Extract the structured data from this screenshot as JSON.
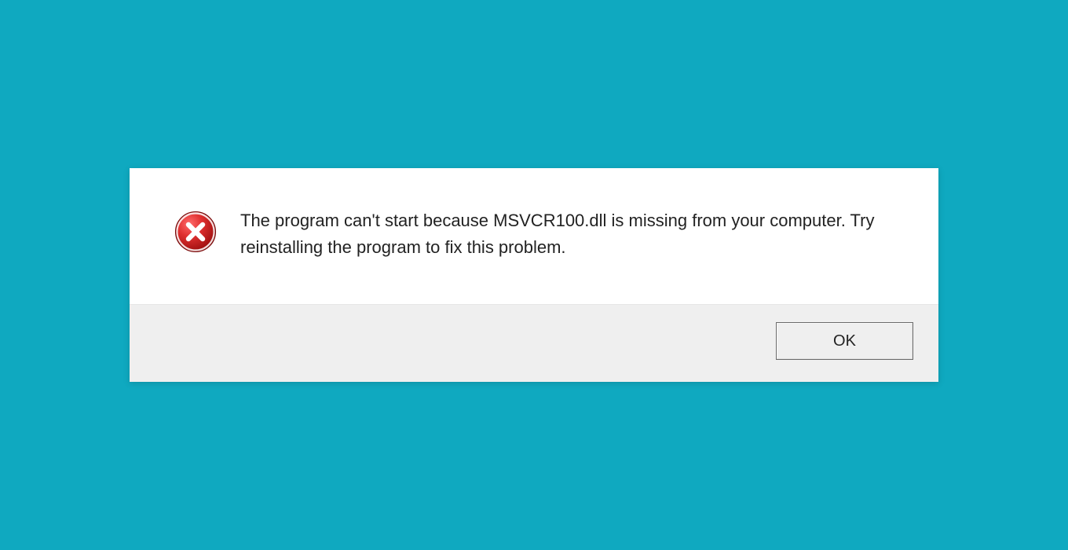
{
  "dialog": {
    "message": "The program can't start because MSVCR100.dll is missing from your computer. Try reinstalling the program to fix this problem.",
    "ok_label": "OK",
    "icon": "error-icon"
  }
}
